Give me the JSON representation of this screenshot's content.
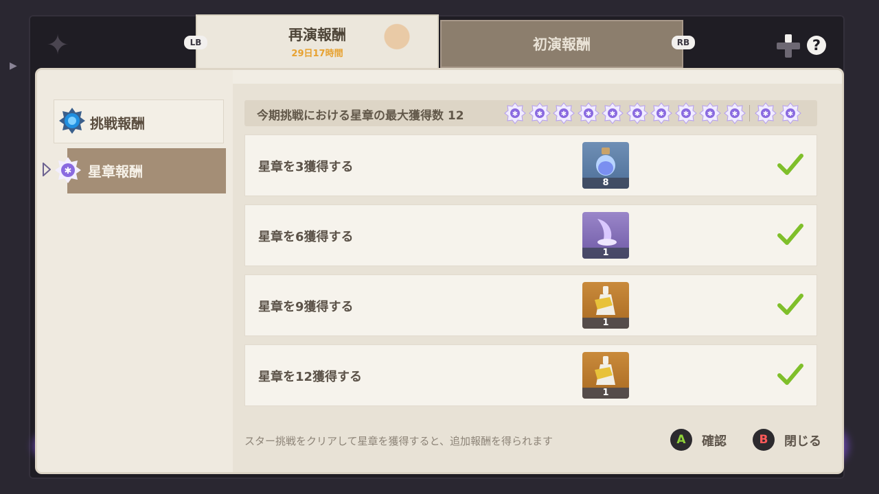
{
  "tabs": [
    {
      "label": "再演報酬",
      "sublabel": "29日17時間",
      "active": true
    },
    {
      "label": "初演報酬",
      "active": false
    }
  ],
  "keys": {
    "left_bumper": "LB",
    "right_bumper": "RB"
  },
  "icons": {
    "help": "?"
  },
  "sidebar": {
    "items": [
      {
        "label": "挑戦報酬",
        "selected": false
      },
      {
        "label": "星章報酬",
        "selected": true
      }
    ]
  },
  "header": {
    "text": "今期挑戦における星章の最大獲得数 12",
    "star_count": 12
  },
  "rewards": [
    {
      "label": "星章を3獲得する",
      "item": "blue-potion-icon",
      "count": "8",
      "claimed": true
    },
    {
      "label": "星章を6獲得する",
      "item": "purple-material-icon",
      "count": "1",
      "claimed": true
    },
    {
      "label": "星章を9獲得する",
      "item": "gold-bottle-icon",
      "count": "1",
      "claimed": true
    },
    {
      "label": "星章を12獲得する",
      "item": "gold-bottle-icon",
      "count": "1",
      "claimed": true
    }
  ],
  "footer": {
    "hint": "スター挑戦をクリアして星章を獲得すると、追加報酬を得られます",
    "confirm": {
      "key": "A",
      "label": "確認"
    },
    "close": {
      "key": "B",
      "label": "閉じる"
    }
  },
  "colors": {
    "accent_orange": "#e7a12f",
    "selected_tab": "#a48e76",
    "check_green": "#7fbf2a",
    "star_purple": "#8a6ae0"
  }
}
